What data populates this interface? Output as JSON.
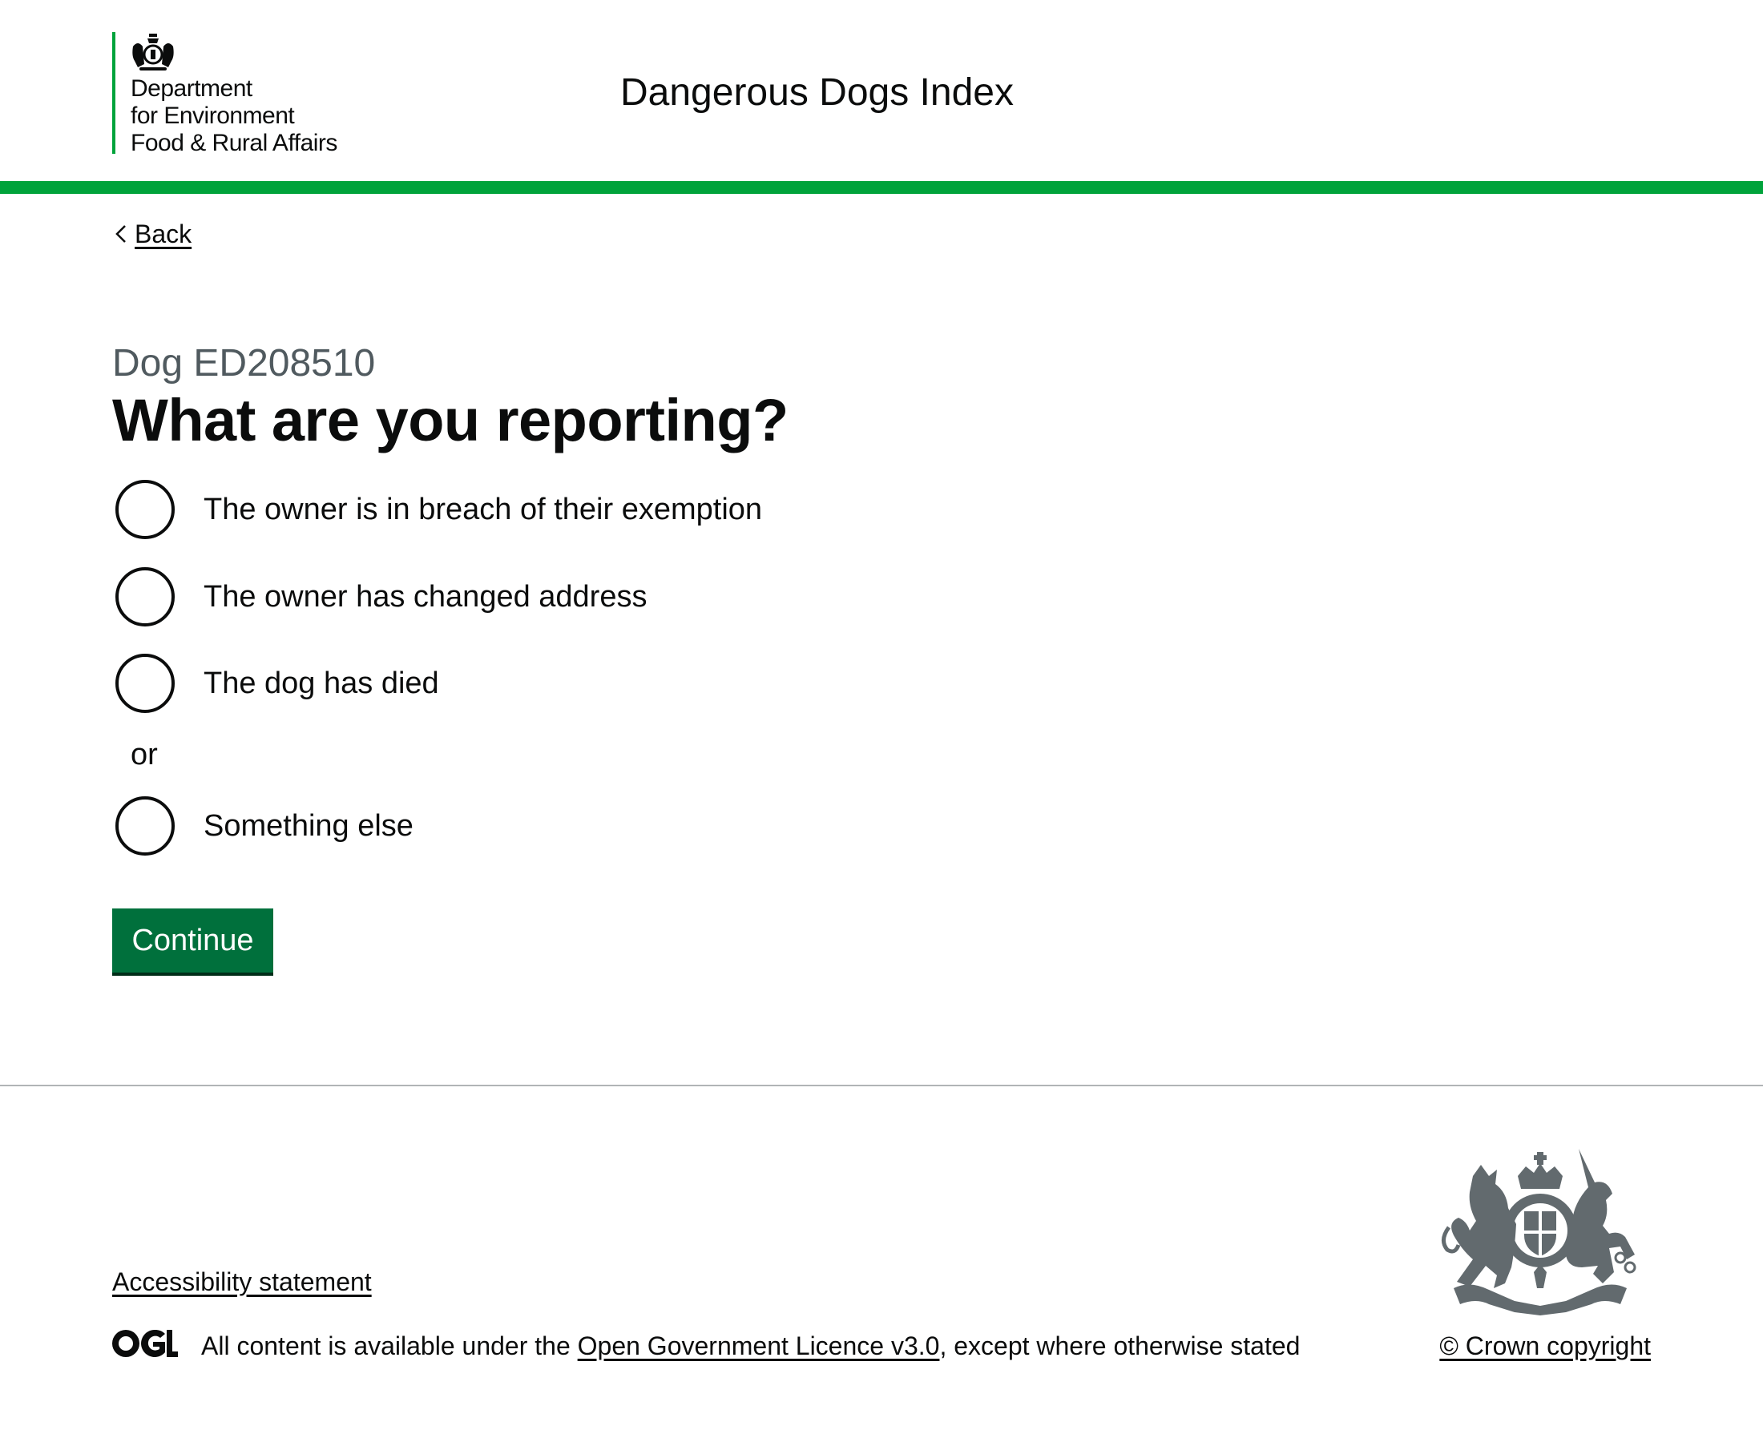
{
  "header": {
    "org_name_lines": [
      "Department",
      "for Environment",
      "Food & Rural Affairs"
    ],
    "service_name": "Dangerous Dogs Index",
    "accent_color": "#00a33b"
  },
  "back_link": {
    "label": "Back"
  },
  "main": {
    "caption": "Dog ED208510",
    "heading": "What are you reporting?",
    "options": [
      {
        "label": "The owner is in breach of their exemption",
        "selected": false
      },
      {
        "label": "The owner has changed address",
        "selected": false
      },
      {
        "label": "The dog has died",
        "selected": false
      },
      {
        "label": "Something else",
        "selected": false
      }
    ],
    "divider": "or",
    "continue_label": "Continue",
    "button_color": "#00703c"
  },
  "footer": {
    "accessibility_label": "Accessibility statement",
    "licence_prefix": "All content is available under the ",
    "licence_link": "Open Government Licence v3.0",
    "licence_suffix": ", except where otherwise stated",
    "copyright_label": "© Crown copyright"
  },
  "icons": {
    "defra_crest": "royal-crest-icon",
    "back": "chevron-left-icon",
    "ogl": "ogl-logo-icon",
    "crown_crest": "royal-coat-of-arms-icon"
  }
}
